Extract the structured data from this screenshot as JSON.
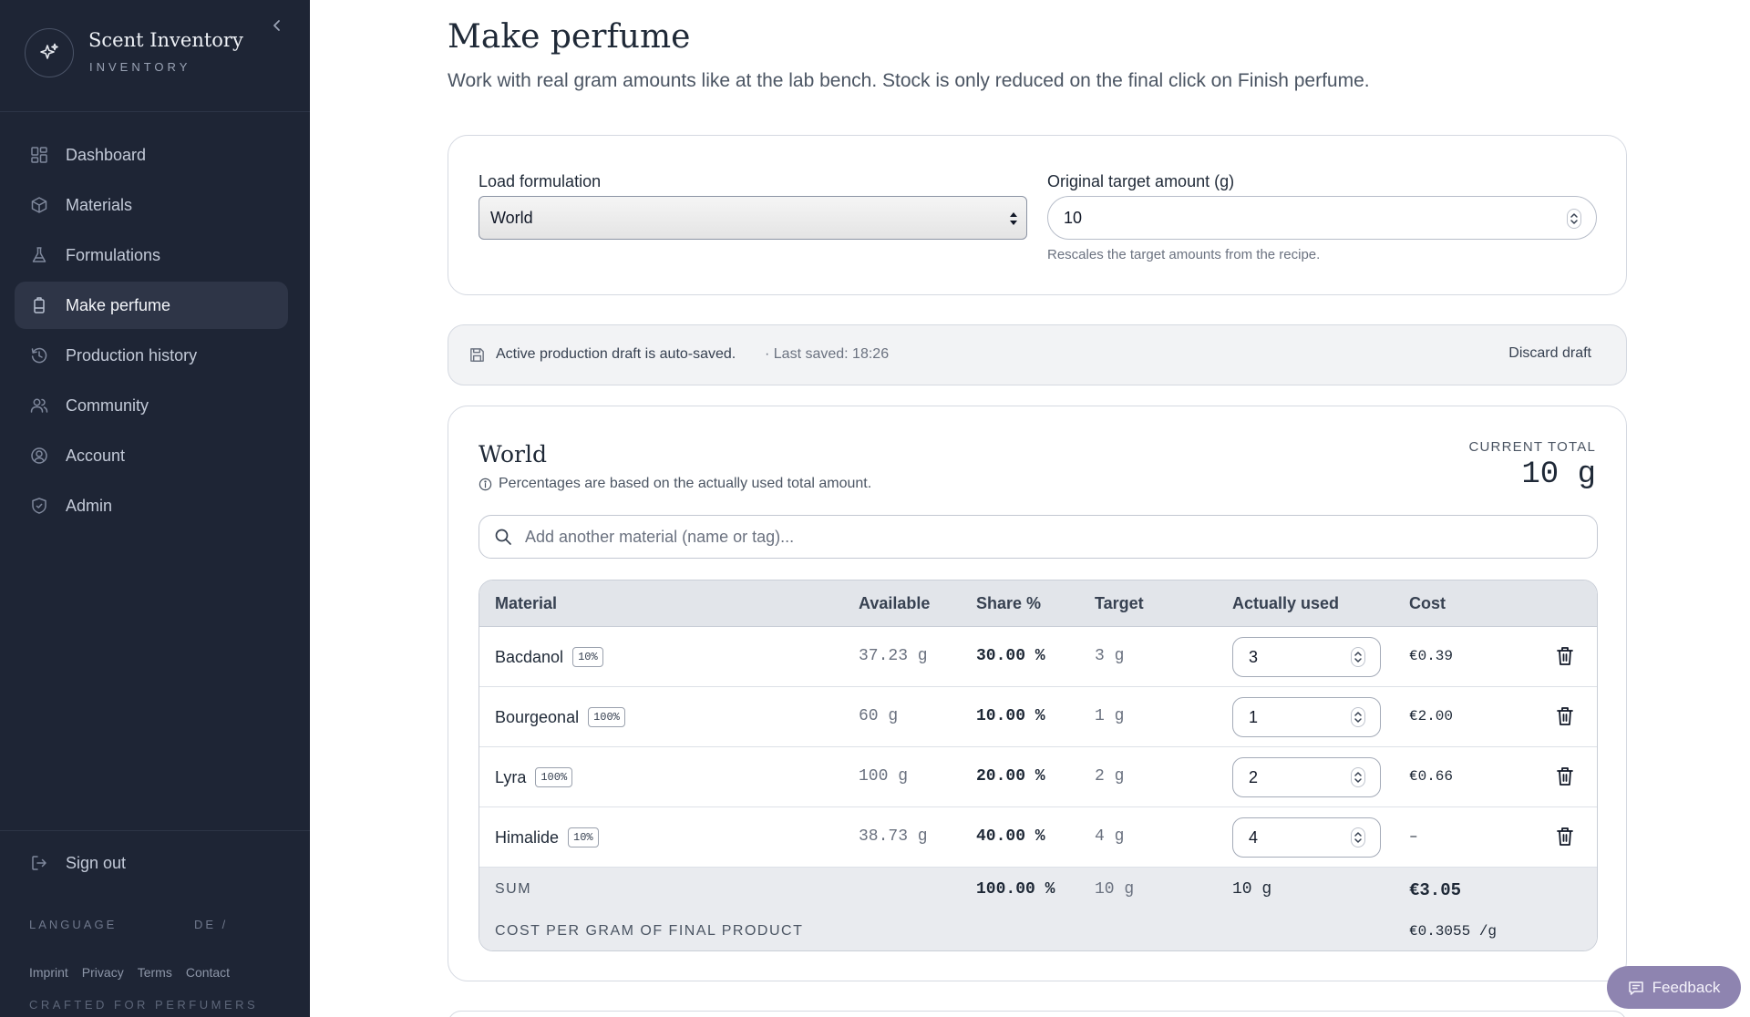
{
  "app": {
    "name": "Scent Inventory",
    "subtitle": "INVENTORY",
    "logo_icon": "sparkles-icon"
  },
  "sidebar": {
    "items": [
      {
        "label": "Dashboard",
        "icon": "dashboard-icon",
        "active": false
      },
      {
        "label": "Materials",
        "icon": "box-icon",
        "active": false
      },
      {
        "label": "Formulations",
        "icon": "flask-icon",
        "active": false
      },
      {
        "label": "Make perfume",
        "icon": "bottle-icon",
        "active": true
      },
      {
        "label": "Production history",
        "icon": "history-icon",
        "active": false
      },
      {
        "label": "Community",
        "icon": "users-icon",
        "active": false
      },
      {
        "label": "Account",
        "icon": "user-circle-icon",
        "active": false
      },
      {
        "label": "Admin",
        "icon": "shield-icon",
        "active": false
      }
    ],
    "sign_out": "Sign out",
    "language_label": "LANGUAGE",
    "language_value": "DE  /",
    "footer_links": [
      "Imprint",
      "Privacy",
      "Terms",
      "Contact"
    ],
    "crafted": "CRAFTED FOR PERFUMERS"
  },
  "page": {
    "title": "Make perfume",
    "subtitle": "Work with real gram amounts like at the lab bench. Stock is only reduced on the final click on Finish perfume."
  },
  "load": {
    "formulation_label": "Load formulation",
    "formulation_value": "World",
    "target_label": "Original target amount (g)",
    "target_value": "10",
    "target_hint": "Rescales the target amounts from the recipe."
  },
  "draft": {
    "text": "Active production draft is auto-saved.",
    "saved": "· Last saved: 18:26",
    "discard": "Discard draft"
  },
  "formula": {
    "title": "World",
    "note": "Percentages are based on the actually used total amount.",
    "total_label": "CURRENT TOTAL",
    "total_value": "10 g",
    "search_placeholder": "Add another material (name or tag)...",
    "columns": {
      "material": "Material",
      "available": "Available",
      "share": "Share %",
      "target": "Target",
      "used": "Actually used",
      "cost": "Cost"
    },
    "rows": [
      {
        "name": "Bacdanol",
        "conc": "10%",
        "available": "37.23 g",
        "share": "30.00 %",
        "target": "3 g",
        "used": "3",
        "cost": "€0.39"
      },
      {
        "name": "Bourgeonal",
        "conc": "100%",
        "available": "60 g",
        "share": "10.00 %",
        "target": "1 g",
        "used": "1",
        "cost": "€2.00"
      },
      {
        "name": "Lyra",
        "conc": "100%",
        "available": "100 g",
        "share": "20.00 %",
        "target": "2 g",
        "used": "2",
        "cost": "€0.66"
      },
      {
        "name": "Himalide",
        "conc": "10%",
        "available": "38.73 g",
        "share": "40.00 %",
        "target": "4 g",
        "used": "4",
        "cost": "–"
      }
    ],
    "sum": {
      "label": "SUM",
      "share": "100.00 %",
      "target": "10 g",
      "used": "10 g",
      "cost": "€3.05"
    },
    "cost_per_gram": {
      "label": "COST PER GRAM OF FINAL PRODUCT",
      "value": "€0.3055 /g"
    }
  },
  "feedback": {
    "label": "Feedback"
  }
}
